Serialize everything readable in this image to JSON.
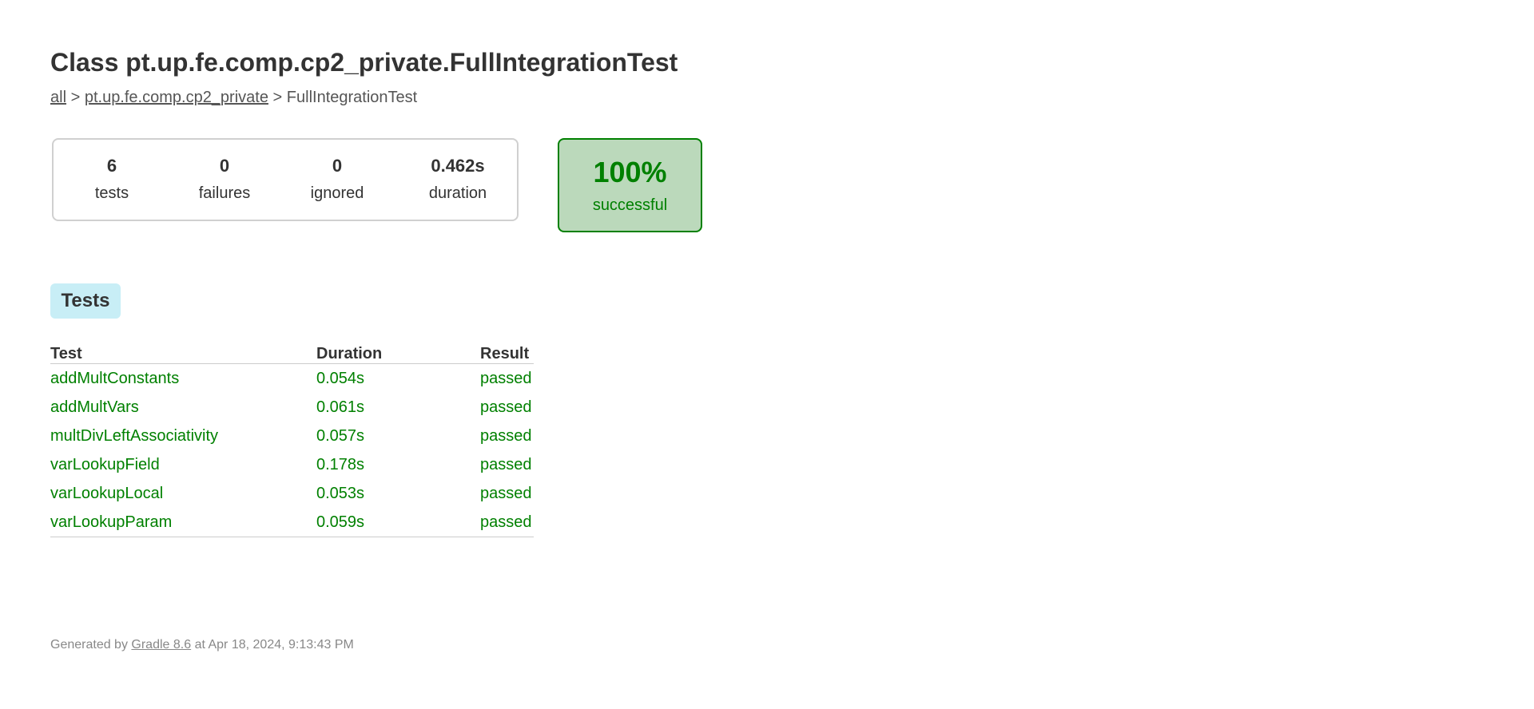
{
  "page": {
    "title": "Class pt.up.fe.comp.cp2_private.FullIntegrationTest"
  },
  "breadcrumb": {
    "root_link": "all",
    "separator": ">",
    "package_link": "pt.up.fe.comp.cp2_private",
    "current": "FullIntegrationTest"
  },
  "summary": {
    "tests": {
      "value": "6",
      "label": "tests"
    },
    "failures": {
      "value": "0",
      "label": "failures"
    },
    "ignored": {
      "value": "0",
      "label": "ignored"
    },
    "duration": {
      "value": "0.462s",
      "label": "duration"
    },
    "success_rate": {
      "value": "100%",
      "label": "successful"
    }
  },
  "tabs": [
    {
      "label": "Tests"
    }
  ],
  "table": {
    "headers": [
      "Test",
      "Duration",
      "Result"
    ],
    "rows": [
      {
        "test": "addMultConstants",
        "duration": "0.054s",
        "result": "passed"
      },
      {
        "test": "addMultVars",
        "duration": "0.061s",
        "result": "passed"
      },
      {
        "test": "multDivLeftAssociativity",
        "duration": "0.057s",
        "result": "passed"
      },
      {
        "test": "varLookupField",
        "duration": "0.178s",
        "result": "passed"
      },
      {
        "test": "varLookupLocal",
        "duration": "0.053s",
        "result": "passed"
      },
      {
        "test": "varLookupParam",
        "duration": "0.059s",
        "result": "passed"
      }
    ]
  },
  "footer": {
    "prefix": "Generated by",
    "link": "Gradle 8.6",
    "suffix": "at Apr 18, 2024, 9:13:43 PM"
  },
  "colors": {
    "success": "#008000",
    "success_bg": "#bbd9bb",
    "tab_bg": "#c8eef6",
    "text": "#333333"
  }
}
